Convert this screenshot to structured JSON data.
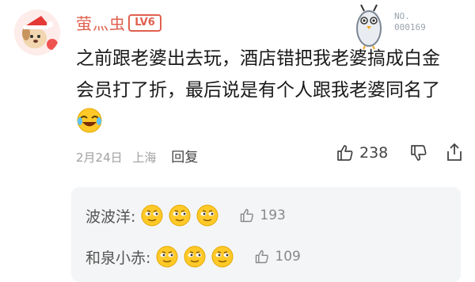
{
  "comment": {
    "username": "萤灬虫",
    "level_badge": "LV6",
    "fan_badge_number": [
      "NO.",
      "000169"
    ],
    "text": "之前跟老婆出去玩，酒店错把我老婆搞成白金会员打了折，最后说是有个人跟我老婆同名了",
    "date": "2月24日",
    "location": "上海",
    "reply_label": "回复",
    "likes": "238",
    "icons": {
      "avatar": "cartoon-dog-santa-hat-avatar",
      "fan_badge": "bird-mascot-icon",
      "inline_emoji": "laughing-cry-emoji",
      "like": "thumbs-up-icon",
      "dislike": "thumbs-down-icon",
      "share": "share-icon"
    }
  },
  "replies": [
    {
      "name": "波波洋:",
      "likes": "193",
      "emoji_count": 3
    },
    {
      "name": "和泉小赤:",
      "likes": "109",
      "emoji_count": 3
    }
  ],
  "colors": {
    "username": "#e0604f",
    "emoji": "#ffc928"
  }
}
